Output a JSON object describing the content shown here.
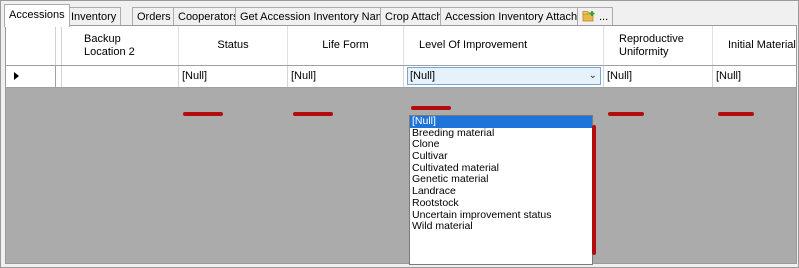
{
  "tabs": [
    {
      "label": "Accessions",
      "active": true
    },
    {
      "label": "Inventory"
    },
    {
      "label": "Orders"
    },
    {
      "label": "Cooperators"
    },
    {
      "label": "Get Accession Inventory Name"
    },
    {
      "label": "Crop Attach"
    },
    {
      "label": "Accession Inventory Attach"
    },
    {
      "label": "...",
      "icon": "add-tab-icon"
    }
  ],
  "grid": {
    "columns": [
      "Backup Location 2",
      "Status",
      "Life Form",
      "Level Of Improvement",
      "Reproductive Uniformity",
      "Initial Material Type"
    ],
    "row": {
      "backup_location_2": "",
      "status": "[Null]",
      "life_form": "[Null]",
      "level_of_improvement": "[Null]",
      "reproductive_uniformity": "[Null]",
      "initial_material_type": "[Null]"
    }
  },
  "dropdown": {
    "selected": "[Null]",
    "options": [
      "[Null]",
      "Breeding material",
      "Clone",
      "Cultivar",
      "Cultivated material",
      "Genetic material",
      "Landrace",
      "Rootstock",
      "Uncertain improvement status",
      "Wild material"
    ]
  },
  "colors": {
    "annotation": "#b10d0d",
    "selection": "#1e74d8",
    "combo_border": "#7aa6d6"
  }
}
